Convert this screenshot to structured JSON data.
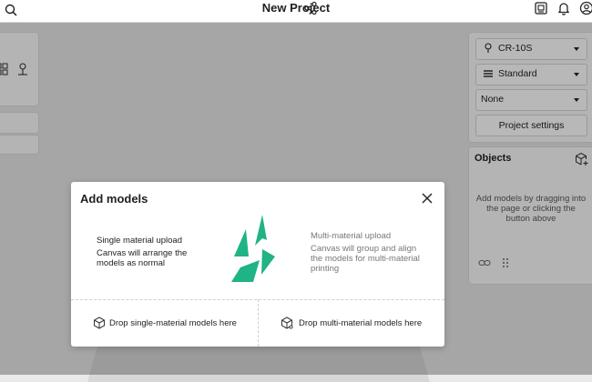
{
  "header": {
    "title": "New Project"
  },
  "printer": {
    "model": "CR-10S",
    "profile": "Standard",
    "support": "None",
    "settings_button": "Project settings"
  },
  "objects": {
    "title": "Objects",
    "empty_text": "Add models by dragging into the page or clicking the button above"
  },
  "modal": {
    "title": "Add models",
    "single": {
      "title": "Single material upload",
      "description": "Canvas will arrange the models as normal"
    },
    "multi": {
      "title": "Multi-material upload",
      "description": "Canvas will group and align the models for multi-material printing"
    },
    "drop_single": "Drop single-material models here",
    "drop_multi": "Drop multi-material models here"
  },
  "colors": {
    "brand": "#1fb386",
    "overlay": "rgba(0,0,0,0.28)"
  },
  "icons": [
    "search-icon",
    "share-icon",
    "printer-icon",
    "bell-icon",
    "user-icon",
    "nozzle-icon",
    "layers-icon",
    "cube-add-icon",
    "link-icon",
    "drag-handle-icon",
    "close-icon",
    "cube-single-icon",
    "cube-multi-icon"
  ]
}
